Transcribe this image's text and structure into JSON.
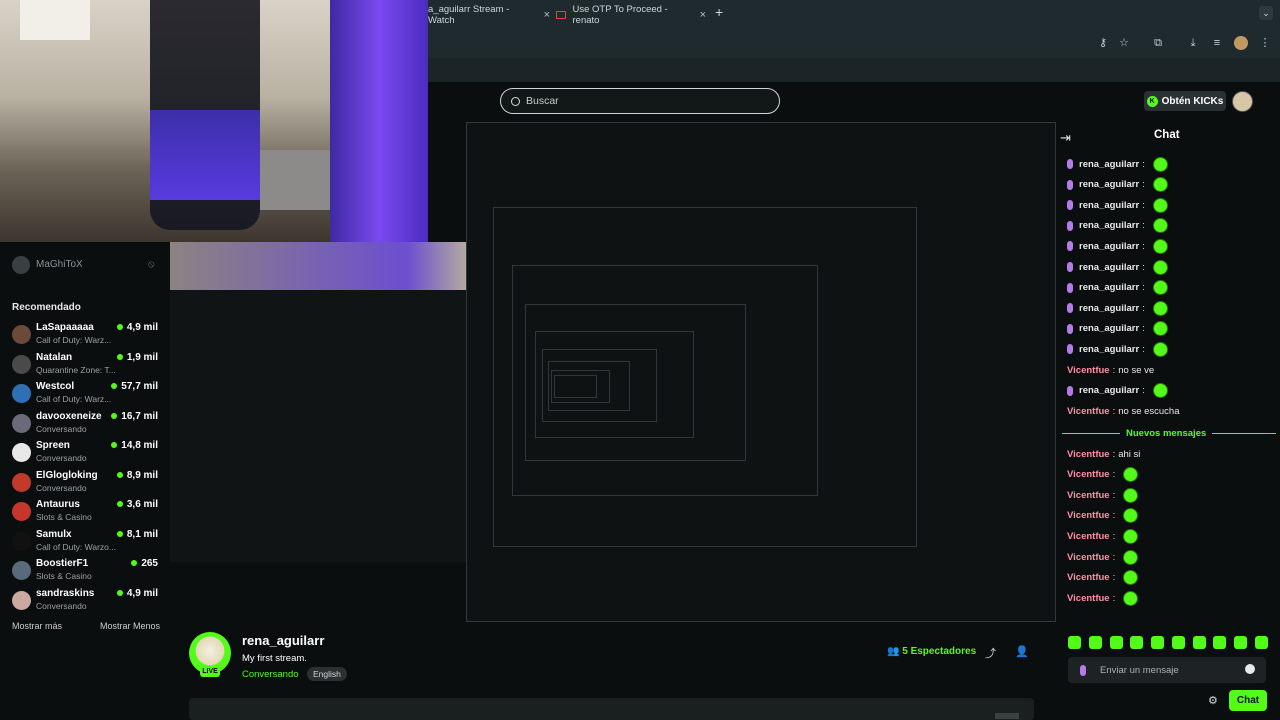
{
  "browser": {
    "tabs": [
      {
        "label": "a_aguilarr Stream - Watch"
      },
      {
        "label": "Use OTP To Proceed - renato"
      }
    ],
    "new_tab": "+",
    "tab_close": "×"
  },
  "header": {
    "search_placeholder": "Buscar",
    "kicks_label": "Obtén KICKs",
    "kicks_badge": "K"
  },
  "sidebar": {
    "followed": {
      "name": "MaGhiToX"
    },
    "heading": "Recomendado",
    "items": [
      {
        "name": "LaSapaaaaa",
        "category": "Call of Duty: Warz...",
        "viewers": "4,9 mil",
        "color": "#6b4a3a"
      },
      {
        "name": "Natalan",
        "category": "Quarantine Zone: T...",
        "viewers": "1,9 mil",
        "color": "#4a4a4a"
      },
      {
        "name": "Westcol",
        "category": "Call of Duty: Warz...",
        "viewers": "57,7 mil",
        "color": "#2f6fb5"
      },
      {
        "name": "davooxeneize",
        "category": "Conversando",
        "viewers": "16,7 mil",
        "color": "#6a6a7a"
      },
      {
        "name": "Spreen",
        "category": "Conversando",
        "viewers": "14,8 mil",
        "color": "#e8e8e8"
      },
      {
        "name": "ElGlogloking",
        "category": "Conversando",
        "viewers": "8,9 mil",
        "color": "#c23a2a"
      },
      {
        "name": "Antaurus",
        "category": "Slots & Casino",
        "viewers": "3,6 mil",
        "color": "#c6362b"
      },
      {
        "name": "Samulx",
        "category": "Call of Duty: Warzo...",
        "viewers": "8,1 mil",
        "color": "#111111"
      },
      {
        "name": "BoostierF1",
        "category": "Slots & Casino",
        "viewers": "265",
        "color": "#5a6a7a"
      },
      {
        "name": "sandraskins",
        "category": "Conversando",
        "viewers": "4,9 mil",
        "color": "#c9a9a0"
      }
    ],
    "show_more": "Mostrar más",
    "show_less": "Mostrar Menos"
  },
  "stream": {
    "live_badge": "LIVE",
    "streamer": "rena_aguilarr",
    "title": "My first stream.",
    "category": "Conversando",
    "language": "English",
    "viewers_count": "5",
    "viewers_label": "Espectadores"
  },
  "chat": {
    "title": "Chat",
    "new_messages": "Nuevos mensajes",
    "messages": [
      {
        "user": "rena_aguilarr",
        "text": "",
        "color": "#e7e9ea",
        "emote": true,
        "mic": true
      },
      {
        "user": "rena_aguilarr",
        "text": "",
        "color": "#e7e9ea",
        "emote": true,
        "mic": true
      },
      {
        "user": "rena_aguilarr",
        "text": "",
        "color": "#e7e9ea",
        "emote": true,
        "mic": true
      },
      {
        "user": "rena_aguilarr",
        "text": "",
        "color": "#e7e9ea",
        "emote": true,
        "mic": true
      },
      {
        "user": "rena_aguilarr",
        "text": "",
        "color": "#e7e9ea",
        "emote": true,
        "mic": true
      },
      {
        "user": "rena_aguilarr",
        "text": "",
        "color": "#e7e9ea",
        "emote": true,
        "mic": true
      },
      {
        "user": "rena_aguilarr",
        "text": "",
        "color": "#e7e9ea",
        "emote": true,
        "mic": true
      },
      {
        "user": "rena_aguilarr",
        "text": "",
        "color": "#e7e9ea",
        "emote": true,
        "mic": true
      },
      {
        "user": "rena_aguilarr",
        "text": "",
        "color": "#e7e9ea",
        "emote": true,
        "mic": true
      },
      {
        "user": "rena_aguilarr",
        "text": "",
        "color": "#e7e9ea",
        "emote": true,
        "mic": true
      },
      {
        "user": "Vicentfue",
        "text": "no se ve",
        "color": "#ff8fa3",
        "emote": false,
        "mic": false
      },
      {
        "user": "rena_aguilarr",
        "text": "",
        "color": "#e7e9ea",
        "emote": true,
        "mic": true
      },
      {
        "user": "Vicentfue",
        "text": "no se escucha",
        "color": "#ff8fa3",
        "emote": false,
        "mic": false
      }
    ],
    "new_messages_list": [
      {
        "user": "Vicentfue",
        "text": "ahi si",
        "color": "#ff8fa3",
        "emote": false
      },
      {
        "user": "Vicentfue",
        "text": "",
        "color": "#ff8fa3",
        "emote": true
      },
      {
        "user": "Vicentfue",
        "text": "",
        "color": "#ff8fa3",
        "emote": true
      },
      {
        "user": "Vicentfue",
        "text": "",
        "color": "#ff8fa3",
        "emote": true
      },
      {
        "user": "Vicentfue",
        "text": "",
        "color": "#ff8fa3",
        "emote": true
      },
      {
        "user": "Vicentfue",
        "text": "",
        "color": "#ff8fa3",
        "emote": true
      },
      {
        "user": "Vicentfue",
        "text": "",
        "color": "#ff8fa3",
        "emote": true
      },
      {
        "user": "Vicentfue",
        "text": "",
        "color": "#ff8fa3",
        "emote": true
      }
    ],
    "input_placeholder": "Enviar un mensaje",
    "send_label": "Chat"
  },
  "colors": {
    "accent": "#53fc18",
    "background": "#0b0e0f"
  }
}
